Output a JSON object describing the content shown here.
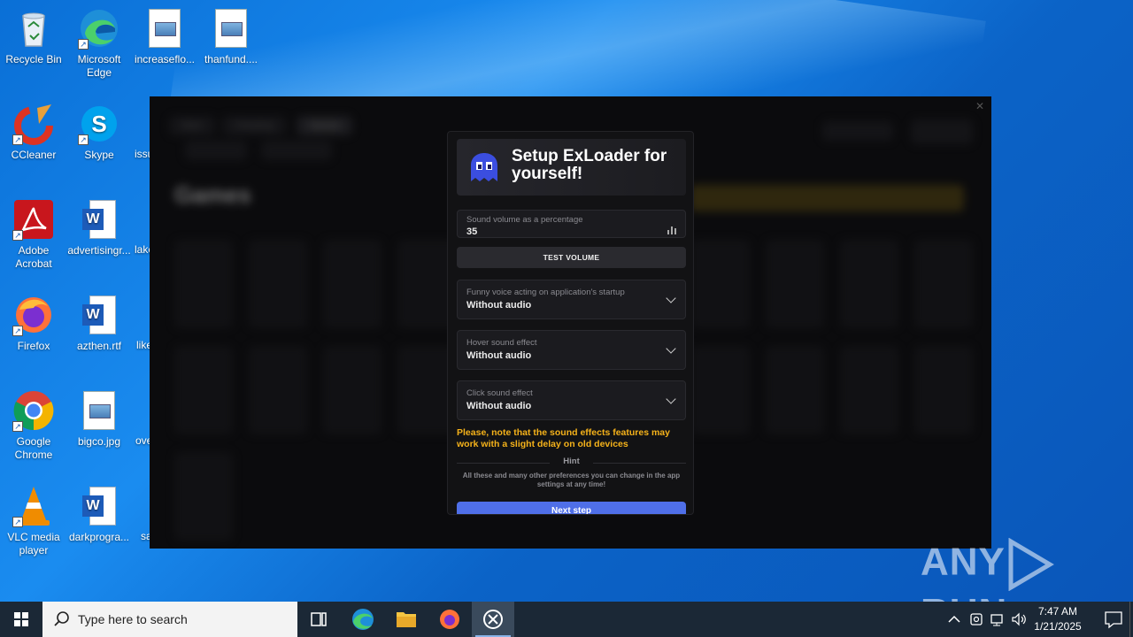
{
  "desktop": {
    "icons": [
      {
        "label": "Recycle Bin"
      },
      {
        "label": "Microsoft Edge"
      },
      {
        "label": "increaseflo..."
      },
      {
        "label": "thanfund...."
      },
      {
        "label": "CCleaner"
      },
      {
        "label": "Skype"
      },
      {
        "label": "issu"
      },
      {
        "label": "Adobe Acrobat"
      },
      {
        "label": "advertisingr..."
      },
      {
        "label": "lake"
      },
      {
        "label": "Firefox"
      },
      {
        "label": "azthen.rtf"
      },
      {
        "label": "like"
      },
      {
        "label": "Google Chrome"
      },
      {
        "label": "bigco.jpg"
      },
      {
        "label": "ove"
      },
      {
        "label": "VLC media player"
      },
      {
        "label": "darkprogra..."
      },
      {
        "label": "sa"
      }
    ]
  },
  "app_background": {
    "title": "Games",
    "tabs": [
      "Main",
      "Cheating",
      "Games"
    ]
  },
  "dialog": {
    "title": "Setup ExLoader for yourself!",
    "volume_label": "Sound volume as a percentage",
    "volume_value": "35",
    "test_volume": "TEST VOLUME",
    "startup_label": "Funny voice acting on application's startup",
    "startup_value": "Without audio",
    "hover_label": "Hover sound effect",
    "hover_value": "Without audio",
    "click_label": "Click sound effect",
    "click_value": "Without audio",
    "warning": "Please, note that the sound effects features may work with a slight delay on old devices",
    "hint_title": "Hint",
    "hint_text": "All these and many other preferences you can change in the app settings at any time!",
    "next_button": "Next step",
    "colors": {
      "accent": "#4f6fe8",
      "warning": "#f5b21a"
    }
  },
  "watermark": {
    "text_left": "ANY",
    "text_right": "RUN"
  },
  "taskbar": {
    "search_placeholder": "Type here to search",
    "time": "7:47 AM",
    "date": "1/21/2025"
  }
}
